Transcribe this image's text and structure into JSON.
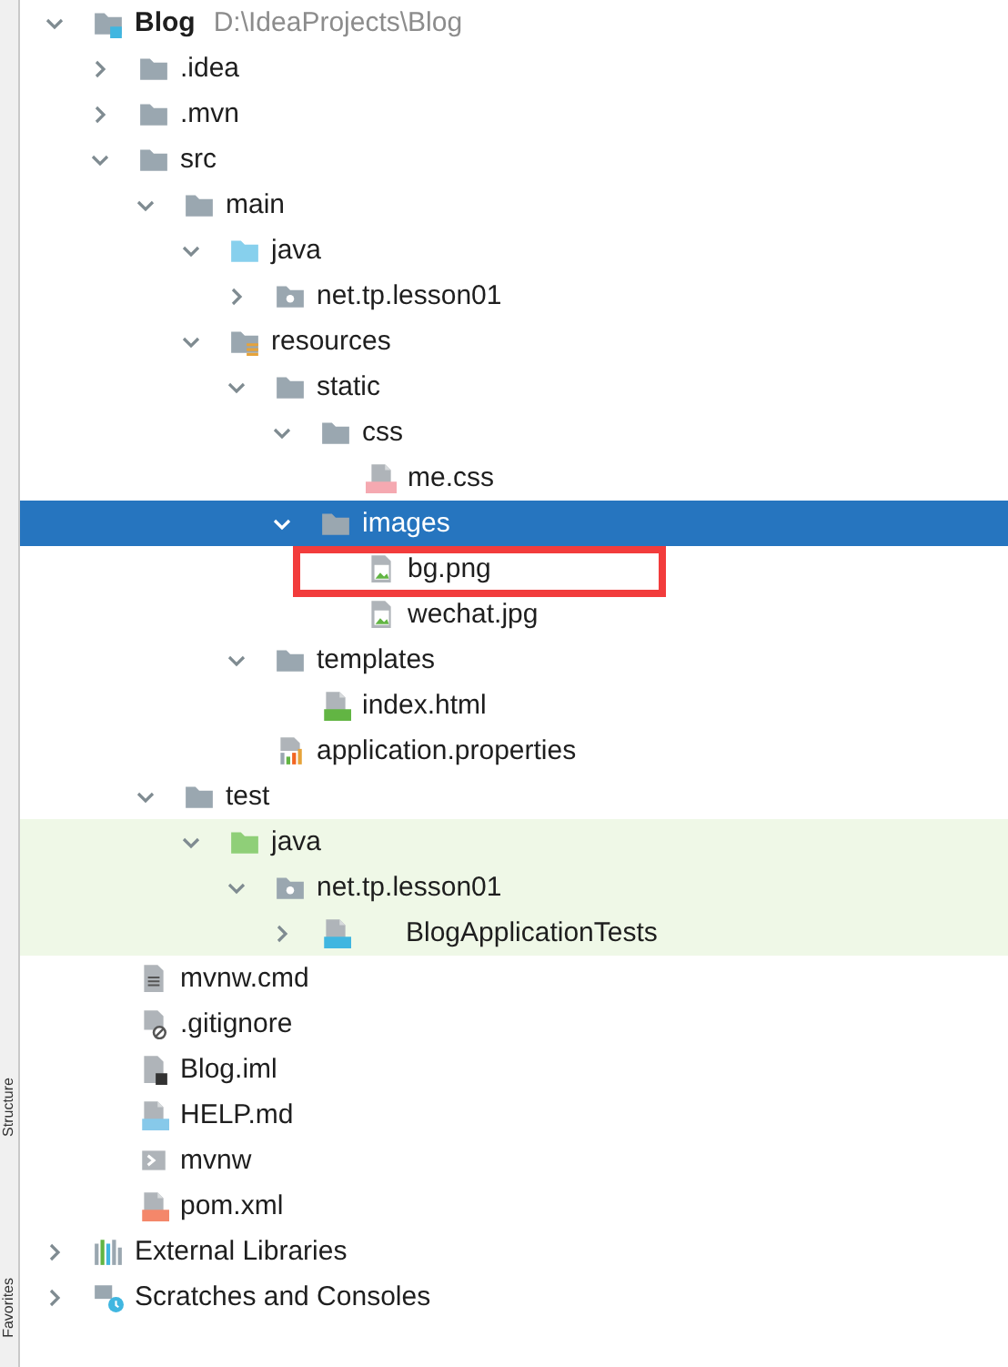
{
  "tool_strip": [
    {
      "label": "Structure"
    },
    {
      "label": "Favorites"
    }
  ],
  "tree": [
    {
      "label": "Blog",
      "path": "D:\\IdeaProjects\\Blog",
      "kind": "module",
      "expanded": true,
      "selected": false,
      "test_source": false,
      "outlined": false,
      "children": [
        {
          "label": ".idea",
          "kind": "folder",
          "expanded": false,
          "selected": false,
          "test_source": false,
          "outlined": false
        },
        {
          "label": ".mvn",
          "kind": "folder",
          "expanded": false,
          "selected": false,
          "test_source": false,
          "outlined": false
        },
        {
          "label": "src",
          "kind": "folder",
          "expanded": true,
          "selected": false,
          "test_source": false,
          "outlined": false,
          "children": [
            {
              "label": "main",
              "kind": "folder",
              "expanded": true,
              "selected": false,
              "test_source": false,
              "outlined": false,
              "children": [
                {
                  "label": "java",
                  "kind": "source-folder",
                  "expanded": true,
                  "selected": false,
                  "test_source": false,
                  "outlined": false,
                  "children": [
                    {
                      "label": "net.tp.lesson01",
                      "kind": "package",
                      "expanded": false,
                      "selected": false,
                      "test_source": false,
                      "outlined": false
                    }
                  ]
                },
                {
                  "label": "resources",
                  "kind": "resources-folder",
                  "expanded": true,
                  "selected": false,
                  "test_source": false,
                  "outlined": false,
                  "children": [
                    {
                      "label": "static",
                      "kind": "folder",
                      "expanded": true,
                      "selected": false,
                      "test_source": false,
                      "outlined": false,
                      "children": [
                        {
                          "label": "css",
                          "kind": "folder",
                          "expanded": true,
                          "selected": false,
                          "test_source": false,
                          "outlined": false,
                          "children": [
                            {
                              "label": "me.css",
                              "kind": "css",
                              "selected": false,
                              "test_source": false,
                              "outlined": false
                            }
                          ]
                        },
                        {
                          "label": "images",
                          "kind": "folder",
                          "expanded": true,
                          "selected": true,
                          "test_source": false,
                          "outlined": false,
                          "children": [
                            {
                              "label": "bg.png",
                              "kind": "image",
                              "selected": false,
                              "test_source": false,
                              "outlined": true
                            },
                            {
                              "label": "wechat.jpg",
                              "kind": "image",
                              "selected": false,
                              "test_source": false,
                              "outlined": false
                            }
                          ]
                        }
                      ]
                    },
                    {
                      "label": "templates",
                      "kind": "folder",
                      "expanded": true,
                      "selected": false,
                      "test_source": false,
                      "outlined": false,
                      "children": [
                        {
                          "label": "index.html",
                          "kind": "html",
                          "selected": false,
                          "test_source": false,
                          "outlined": false
                        }
                      ]
                    },
                    {
                      "label": "application.properties",
                      "kind": "properties",
                      "selected": false,
                      "test_source": false,
                      "outlined": false
                    }
                  ]
                }
              ]
            },
            {
              "label": "test",
              "kind": "folder",
              "expanded": true,
              "selected": false,
              "test_source": false,
              "outlined": false,
              "children": [
                {
                  "label": "java",
                  "kind": "test-folder",
                  "expanded": true,
                  "selected": false,
                  "test_source": true,
                  "outlined": false,
                  "children": [
                    {
                      "label": "net.tp.lesson01",
                      "kind": "package",
                      "expanded": true,
                      "selected": false,
                      "test_source": true,
                      "outlined": false,
                      "children": [
                        {
                          "label": "BlogApplicationTests",
                          "kind": "java-class",
                          "expanded": false,
                          "selected": false,
                          "test_source": true,
                          "outlined": false
                        }
                      ]
                    }
                  ]
                }
              ]
            }
          ]
        },
        {
          "label": "mvnw.cmd",
          "kind": "text",
          "selected": false,
          "test_source": false,
          "outlined": false
        },
        {
          "label": ".gitignore",
          "kind": "ignore",
          "selected": false,
          "test_source": false,
          "outlined": false
        },
        {
          "label": "Blog.iml",
          "kind": "iml",
          "selected": false,
          "test_source": false,
          "outlined": false
        },
        {
          "label": "HELP.md",
          "kind": "markdown",
          "selected": false,
          "test_source": false,
          "outlined": false
        },
        {
          "label": "mvnw",
          "kind": "shell",
          "selected": false,
          "test_source": false,
          "outlined": false
        },
        {
          "label": "pom.xml",
          "kind": "xml",
          "selected": false,
          "test_source": false,
          "outlined": false
        }
      ]
    },
    {
      "label": "External Libraries",
      "kind": "libraries",
      "expanded": false,
      "selected": false,
      "test_source": false,
      "outlined": false
    },
    {
      "label": "Scratches and Consoles",
      "kind": "scratches",
      "expanded": false,
      "selected": false,
      "test_source": false,
      "outlined": false
    }
  ]
}
